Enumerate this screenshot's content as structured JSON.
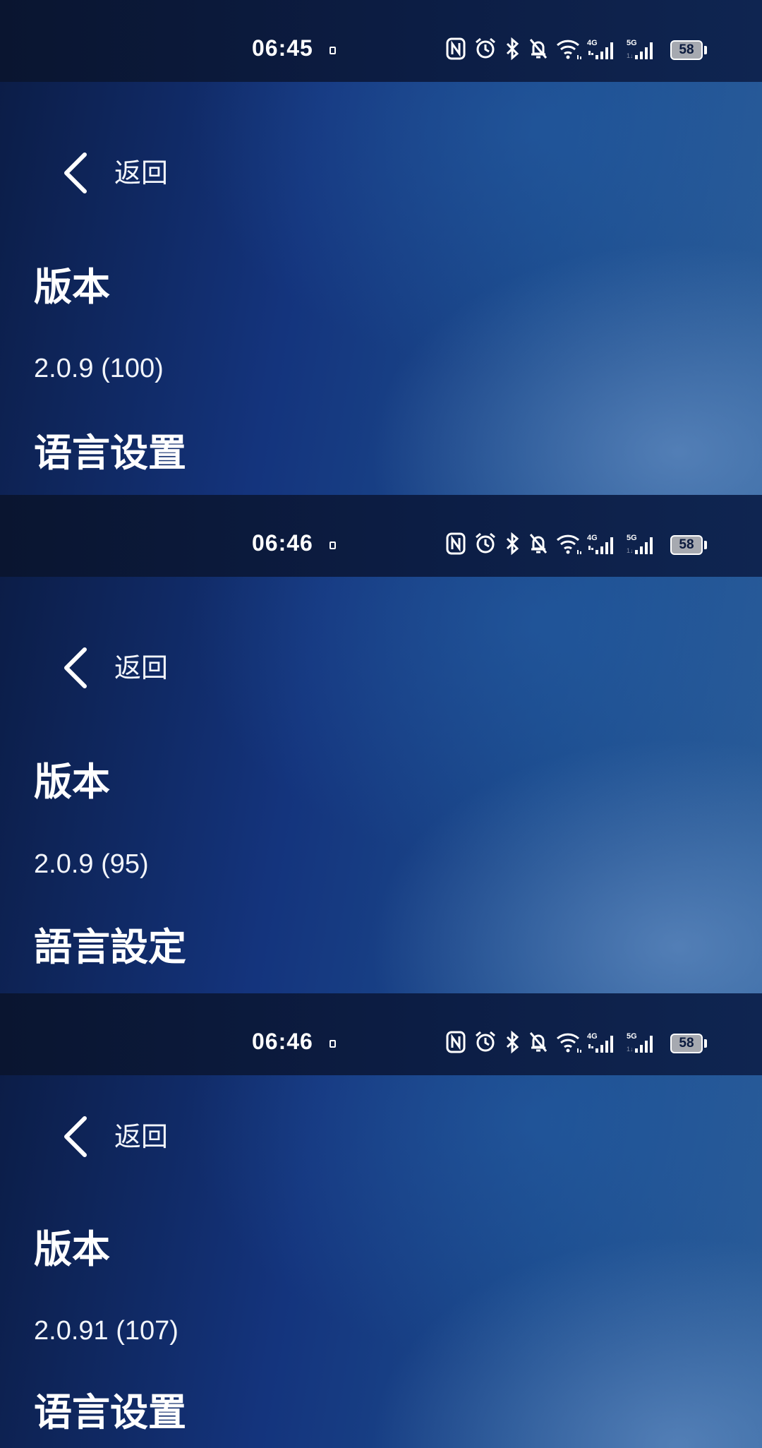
{
  "screens": [
    {
      "status": {
        "time": "06:45",
        "battery": "58",
        "network1": "4G",
        "network2": "5G"
      },
      "back_label": "返回",
      "version_heading": "版本",
      "version_value": "2.0.9 (100)",
      "language_heading": "语言设置"
    },
    {
      "status": {
        "time": "06:46",
        "battery": "58",
        "network1": "4G",
        "network2": "5G"
      },
      "back_label": "返回",
      "version_heading": "版本",
      "version_value": "2.0.9 (95)",
      "language_heading": "語言設定"
    },
    {
      "status": {
        "time": "06:46",
        "battery": "58",
        "network1": "4G",
        "network2": "5G"
      },
      "back_label": "返回",
      "version_heading": "版本",
      "version_value": "2.0.91 (107)",
      "language_heading": "语言设置"
    }
  ],
  "icons": [
    "nfc-icon",
    "alarm-icon",
    "bluetooth-icon",
    "mute-bell-icon",
    "wifi-icon",
    "signal-icon",
    "battery-icon",
    "back-chevron-icon"
  ]
}
